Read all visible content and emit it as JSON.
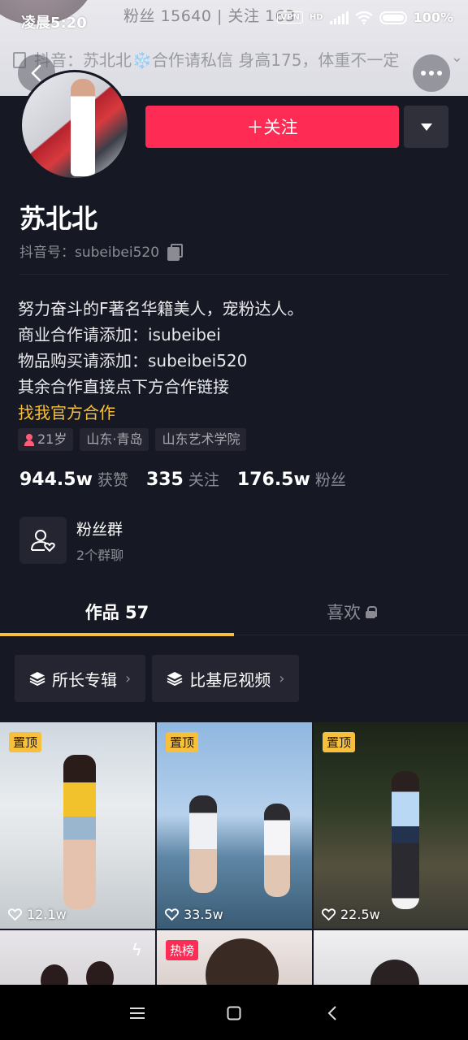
{
  "status_bar": {
    "time": "凌晨5:20",
    "vpn": "VPN",
    "network": "HD",
    "battery": "100%"
  },
  "cover": {
    "stats_text": "粉丝 15640 | 关注 163",
    "signature": "抖音：苏北北❄️合作请私信 身高175，体重不一定"
  },
  "actions": {
    "follow_label": "＋关注"
  },
  "profile": {
    "name": "苏北北",
    "douyin_id": "抖音号：subeibei520",
    "bio": [
      "努力奋斗的F著名华籍美人，宠粉达人。",
      "商业合作请添加：isubeibei",
      "物品购买请添加：subeibei520",
      "其余合作直接点下方合作链接"
    ],
    "official_link": "找我官方合作",
    "tags": [
      "21岁",
      "山东·青岛",
      "山东艺术学院"
    ]
  },
  "stats": [
    {
      "value": "944.5w",
      "label": "获赞"
    },
    {
      "value": "335",
      "label": "关注"
    },
    {
      "value": "176.5w",
      "label": "粉丝"
    }
  ],
  "fan_group": {
    "title": "粉丝群",
    "subtitle": "2个群聊"
  },
  "tabs": {
    "works": "作品 57",
    "likes": "喜欢"
  },
  "albums": [
    {
      "label": "所长专辑"
    },
    {
      "label": "比基尼视频"
    }
  ],
  "videos": [
    {
      "badge": "置顶",
      "likes": "12.1w"
    },
    {
      "badge": "置顶",
      "likes": "33.5w"
    },
    {
      "badge": "置顶",
      "likes": "22.5w"
    },
    {
      "badge": "",
      "likes": ""
    },
    {
      "badge": "热榜",
      "likes": ""
    },
    {
      "badge": "",
      "likes": ""
    }
  ],
  "colors": {
    "background": "#161823",
    "accent_red": "#fe2c55",
    "accent_yellow": "#f6c03c"
  }
}
